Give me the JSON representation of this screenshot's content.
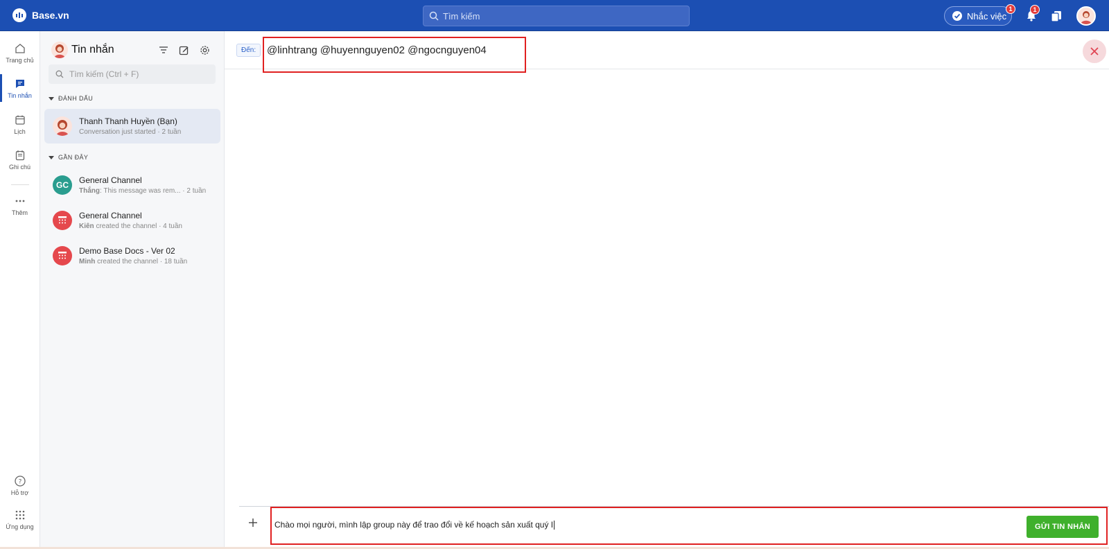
{
  "app": {
    "brand": "Base.vn"
  },
  "topbar": {
    "search_placeholder": "Tìm kiếm",
    "remind_label": "Nhắc việc",
    "remind_badge": "1",
    "notification_badge": "1"
  },
  "rail": {
    "items": [
      {
        "label": "Trang chủ",
        "icon": "home-icon"
      },
      {
        "label": "Tin nhắn",
        "icon": "chat-icon"
      },
      {
        "label": "Lịch",
        "icon": "calendar-icon"
      },
      {
        "label": "Ghi chú",
        "icon": "notes-icon"
      },
      {
        "label": "Thêm",
        "icon": "more-icon"
      }
    ],
    "help_label": "Hỗ trợ",
    "apps_label": "Ứng dụng"
  },
  "panel": {
    "title": "Tin nhắn",
    "search_placeholder": "Tìm kiếm (Ctrl + F)",
    "section_pinned": "ĐÁNH DẤU",
    "section_recent": "GẦN ĐÂY",
    "pinned": [
      {
        "name": "Thanh Thanh Huyền (Bạn)",
        "sub_author": "",
        "sub_text": "Conversation just started · 2 tuần"
      }
    ],
    "recent": [
      {
        "initials": "GC",
        "name": "General Channel",
        "sub_author": "Thắng",
        "sub_text": ": This message was rem...  · 2 tuần",
        "color": "#2a9d8f"
      },
      {
        "initials": "",
        "name": "General Channel",
        "sub_author": "Kiên",
        "sub_text": " created the channel · 4 tuần",
        "color": "#e5484d"
      },
      {
        "initials": "",
        "name": "Demo Base Docs - Ver 02",
        "sub_author": "Minh",
        "sub_text": " created the channel · 18 tuần",
        "color": "#e5484d"
      }
    ]
  },
  "main": {
    "to_label": "Đến:",
    "recipients": "@linhtrang @huyennguyen02 @ngocnguyen04",
    "compose_text": "Chào mọi người, mình lập group này để trao đổi về kế hoạch sản xuất quý I",
    "send_label": "GỬI TIN NHẮN"
  },
  "colors": {
    "brand": "#1c4fb3",
    "send": "#3fb02c",
    "highlight": "#e02020"
  }
}
